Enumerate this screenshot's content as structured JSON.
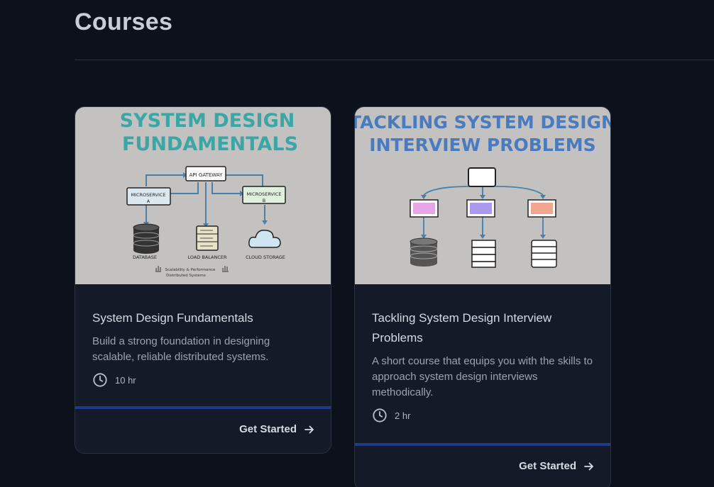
{
  "page": {
    "title": "Courses"
  },
  "courses": [
    {
      "thumb": {
        "heading_line1": "SYSTEM DESIGN",
        "heading_line2": "FUNDAMENTALS",
        "heading_color": "#3aa6a6",
        "api": "API GATEWAY",
        "msa": "MICROSERVICE",
        "msa_sub": "A",
        "msb": "MICROSERVICE",
        "msb_sub": "B",
        "db": "DATABASE",
        "lb": "LOAD BALANCER",
        "cloud": "CLOUD STORAGE",
        "footer1": "Scalability & Performance",
        "footer2": "Distributed Systems"
      },
      "title": "System Design Fundamentals",
      "description": "Build a strong foundation in designing scalable, reliable distributed systems.",
      "duration": "10 hr",
      "cta": "Get Started"
    },
    {
      "thumb": {
        "heading_line1": "TACKLING SYSTEM DESIGN",
        "heading_line2": "INTERVIEW PROBLEMS",
        "heading_color": "#4a7bbf"
      },
      "title": "Tackling System Design Interview Problems",
      "description": "A short course that equips you with the skills to approach system design interviews methodically.",
      "duration": "2 hr",
      "cta": "Get Started"
    }
  ],
  "icons": {
    "clock": "clock-icon",
    "arrow": "arrow-right-icon"
  },
  "colors": {
    "accent_bar": "#1f3a8a",
    "background": "#0d111b",
    "card": "#141a27"
  }
}
